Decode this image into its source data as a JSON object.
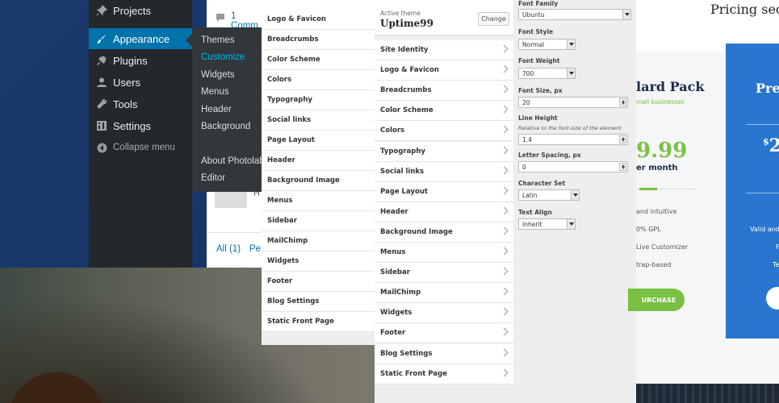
{
  "wp_menu": [
    {
      "label": "Projects",
      "icon": "pin-icon"
    },
    {
      "label": "Appearance",
      "icon": "brush-icon",
      "active": true
    },
    {
      "label": "Plugins",
      "icon": "plug-icon"
    },
    {
      "label": "Users",
      "icon": "user-icon"
    },
    {
      "label": "Tools",
      "icon": "wrench-icon"
    },
    {
      "label": "Settings",
      "icon": "settings-icon"
    },
    {
      "label": "Collapse menu",
      "icon": "collapse-icon"
    }
  ],
  "appearance_submenu": [
    "Themes",
    "Customize",
    "Widgets",
    "Menus",
    "Header",
    "Background",
    "About Photolab",
    "Editor"
  ],
  "comments_panel": {
    "comment_link": "1 Comm",
    "footer_all": "All (1)",
    "footer_more": "Per",
    "row_initial": "H"
  },
  "back_list": [
    "Logo & Favicon",
    "Breadcrumbs",
    "Color Scheme",
    "Colors",
    "Typography",
    "Social links",
    "Page Layout",
    "Header",
    "Background Image",
    "Menus",
    "Sidebar",
    "MailChimp",
    "Widgets",
    "Footer",
    "Blog Settings",
    "Static Front Page"
  ],
  "customizer": {
    "active_theme_label": "Active theme",
    "theme_name": "Uptime99",
    "change_label": "Change",
    "sections": [
      "Site Identity",
      "Logo & Favicon",
      "Breadcrumbs",
      "Color Scheme",
      "Colors",
      "Typography",
      "Social links",
      "Page Layout",
      "Header",
      "Background Image",
      "Menus",
      "Sidebar",
      "MailChimp",
      "Widgets",
      "Footer",
      "Blog Settings",
      "Static Front Page"
    ]
  },
  "typography": {
    "font_family_label": "Font Family",
    "font_family": "Ubuntu",
    "font_style_label": "Font Style",
    "font_style": "Normal",
    "font_weight_label": "Font Weight",
    "font_weight": "700",
    "font_size_label": "Font Size, px",
    "font_size": "20",
    "line_height_label": "Line Height",
    "line_height_note": "Relative to the font-size of the element",
    "line_height": "1.4",
    "letter_spacing_label": "Letter Spacing, px",
    "letter_spacing": "0",
    "charset_label": "Character Set",
    "charset": "Latin",
    "text_align_label": "Text Align",
    "text_align": "Inherit"
  },
  "pricing": {
    "section_title": "Pricing sect",
    "standard_name": "lard Pack",
    "standard_tagline": "mall businesses",
    "standard_price": "9.99",
    "standard_period": "er month",
    "standard_features": [
      "and intuitive",
      "0% GPL",
      "Live Customizer",
      "trap-based"
    ],
    "standard_button": "URCHASE",
    "premium_name": "Pre",
    "premium_price_symbol": "$",
    "premium_price": "2",
    "premium_features": [
      "Valid and",
      "F",
      "Te"
    ]
  }
}
